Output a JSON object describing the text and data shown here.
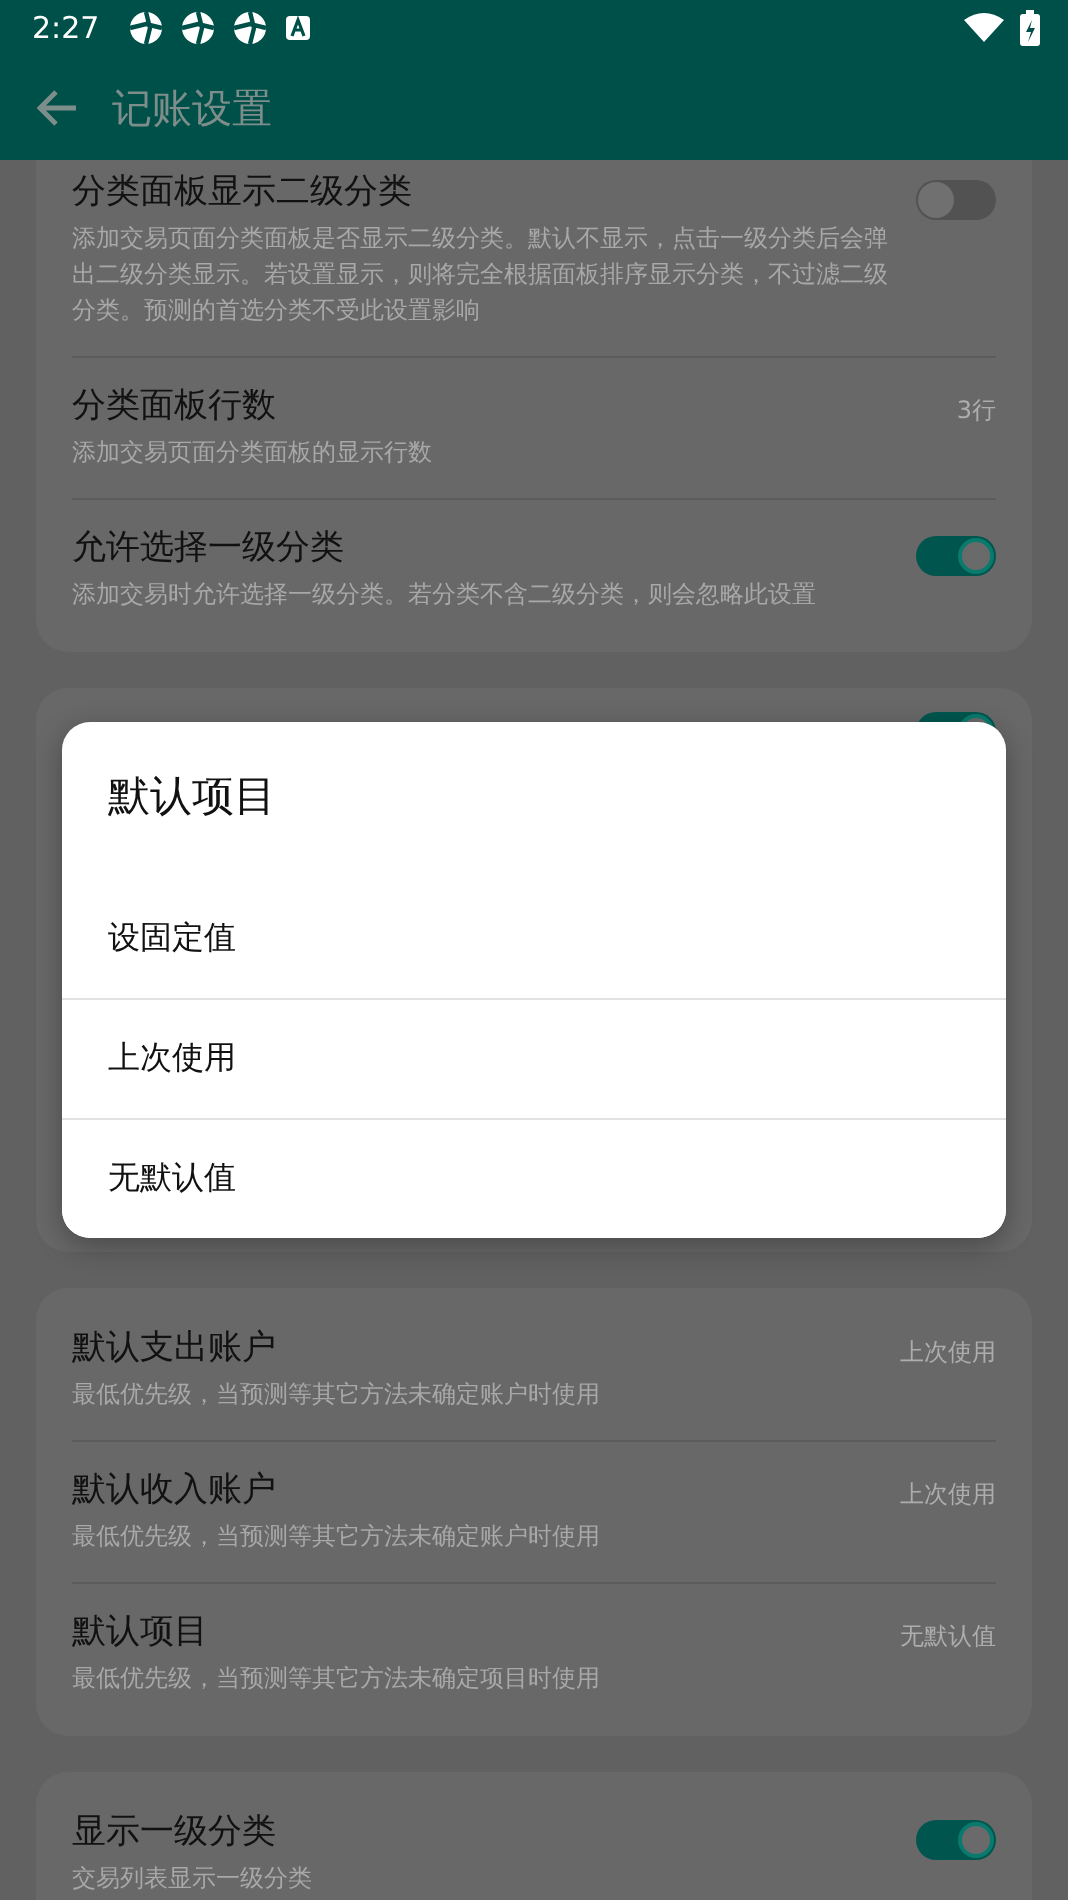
{
  "status_bar": {
    "time": "2:27"
  },
  "app_bar": {
    "title": "记账设置"
  },
  "cards": [
    {
      "items": [
        {
          "kind": "switch",
          "title": "分类面板显示二级分类",
          "description": "添加交易页面分类面板是否显示二级分类。默认不显示，点击一级分类后会弹出二级分类显示。若设置显示，则将完全根据面板排序显示分类，不过滤二级分类。预测的首选分类不受此设置影响",
          "on": false
        },
        {
          "kind": "value",
          "title": "分类面板行数",
          "description": "添加交易页面分类面板的显示行数",
          "value": "3行"
        },
        {
          "kind": "switch",
          "title": "允许选择一级分类",
          "description": "添加交易时允许选择一级分类。若分类不含二级分类，则会忽略此设置",
          "on": true
        }
      ]
    },
    {
      "items": [
        {
          "kind": "switch",
          "on": true
        }
      ]
    },
    {
      "items": [
        {
          "kind": "value",
          "title": "默认支出账户",
          "description": "最低优先级，当预测等其它方法未确定账户时使用",
          "value": "上次使用"
        },
        {
          "kind": "value",
          "title": "默认收入账户",
          "description": "最低优先级，当预测等其它方法未确定账户时使用",
          "value": "上次使用"
        },
        {
          "kind": "value",
          "title": "默认项目",
          "description": "最低优先级，当预测等其它方法未确定项目时使用",
          "value": "无默认值"
        }
      ]
    },
    {
      "items": [
        {
          "kind": "switch",
          "title": "显示一级分类",
          "description": "交易列表显示一级分类",
          "on": true
        }
      ]
    }
  ],
  "dialog": {
    "title": "默认项目",
    "options": [
      {
        "label": "设固定值"
      },
      {
        "label": "上次使用"
      },
      {
        "label": "无默认值"
      }
    ]
  }
}
